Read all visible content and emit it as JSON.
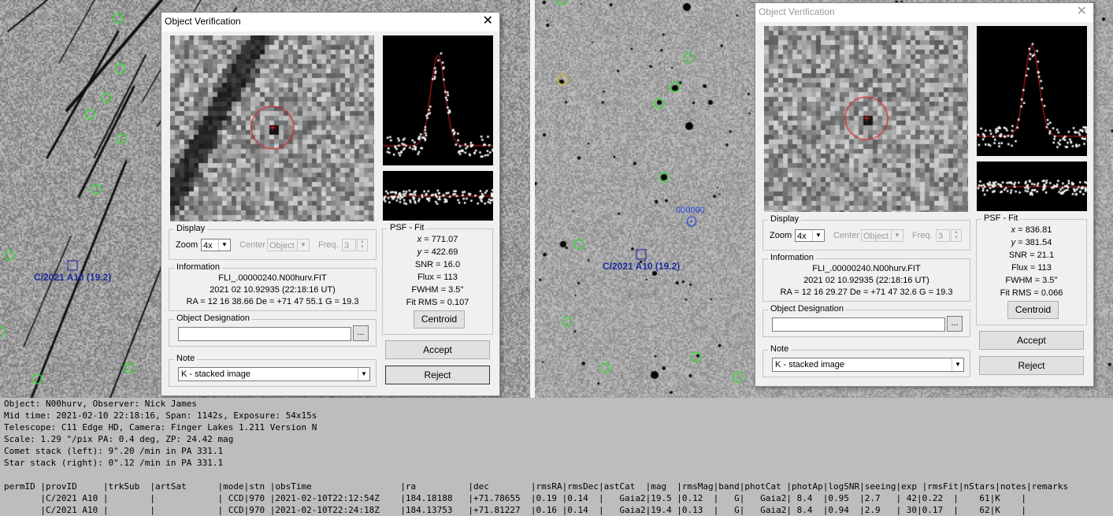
{
  "left_pane": {
    "object_label": "C/2021 A10 (19.2)"
  },
  "right_pane": {
    "object_label": "C/2021 A10 (19.2)",
    "candidate_label": "000000"
  },
  "dialog_left": {
    "title": "Object Verification",
    "close": "✕",
    "display": {
      "group_label": "Display",
      "zoom_label": "Zoom",
      "zoom_value": "4x",
      "center_label": "Center",
      "center_value": "Object",
      "freq_label": "Freq.",
      "freq_value": "3"
    },
    "information": {
      "group_label": "Information",
      "filename": "FLI_.00000240.N00hurv.FIT",
      "date": "2021 02 10.92935 (22:18:16 UT)",
      "coords": "RA = 12 16 38.66   De = +71 47 55.1   G = 19.3"
    },
    "designation": {
      "group_label": "Object Designation",
      "value": "",
      "browse": "..."
    },
    "note": {
      "group_label": "Note",
      "value": "K - stacked image"
    },
    "psf": {
      "group_label": "PSF - Fit",
      "x_key": "x",
      "x_val": " = 771.07",
      "y_key": "y",
      "y_val": " = 422.69",
      "snr": "SNR = 16.0",
      "flux": "Flux = 113",
      "fwhm": "FWHM = 3.5''",
      "fitrms": "Fit RMS = 0.107",
      "centroid": "Centroid"
    },
    "accept": "Accept",
    "reject": "Reject"
  },
  "dialog_right": {
    "title": "Object Verification",
    "close": "✕",
    "display": {
      "group_label": "Display",
      "zoom_label": "Zoom",
      "zoom_value": "4x",
      "center_label": "Center",
      "center_value": "Object",
      "freq_label": "Freq.",
      "freq_value": "3"
    },
    "information": {
      "group_label": "Information",
      "filename": "FLI_.00000240.N00hurv.FIT",
      "date": "2021 02 10.92935 (22:18:16 UT)",
      "coords": "RA = 12 16 29.27   De = +71 47 32.6   G = 19.3"
    },
    "designation": {
      "group_label": "Object Designation",
      "value": "",
      "browse": "..."
    },
    "note": {
      "group_label": "Note",
      "value": "K - stacked image"
    },
    "psf": {
      "group_label": "PSF - Fit",
      "x_key": "x",
      "x_val": " = 836.81",
      "y_key": "y",
      "y_val": " = 381.54",
      "snr": "SNR = 21.1",
      "flux": "Flux = 113",
      "fwhm": "FWHM = 3.5''",
      "fitrms": "Fit RMS = 0.066",
      "centroid": "Centroid"
    },
    "accept": "Accept",
    "reject": "Reject"
  },
  "console": {
    "lines": [
      "Object: N00hurv, Observer: Nick James",
      "Mid time: 2021-02-10 22:18:16, Span: 1142s, Exposure: 54x15s",
      "Telescope: C11 Edge HD, Camera: Finger Lakes 1.211 Version N",
      "Scale: 1.29 \"/pix PA: 0.4 deg, ZP: 24.42 mag",
      "Comet stack (left): 9\".20 /min in PA 331.1",
      "Star stack (right): 0\".12 /min in PA 331.1",
      "",
      "permID |provID     |trkSub  |artSat      |mode|stn |obsTime                 |ra          |dec        |rmsRA|rmsDec|astCat  |mag  |rmsMag|band|photCat |photAp|logSNR|seeing|exp |rmsFit|nStars|notes|remarks",
      "       |C/2021 A10 |        |            | CCD|970 |2021-02-10T22:12:54Z    |184.18188   |+71.78655  |0.19 |0.14  |   Gaia2|19.5 |0.12  |   G|   Gaia2| 8.4  |0.95  |2.7   | 42|0.22  |    61|K    |",
      "       |C/2021 A10 |        |            | CCD|970 |2021-02-10T22:24:18Z    |184.13753   |+71.81227  |0.16 |0.14  |   Gaia2|19.4 |0.13  |   G|   Gaia2| 8.4  |0.94  |2.9   | 30|0.17  |    62|K    |"
    ]
  }
}
